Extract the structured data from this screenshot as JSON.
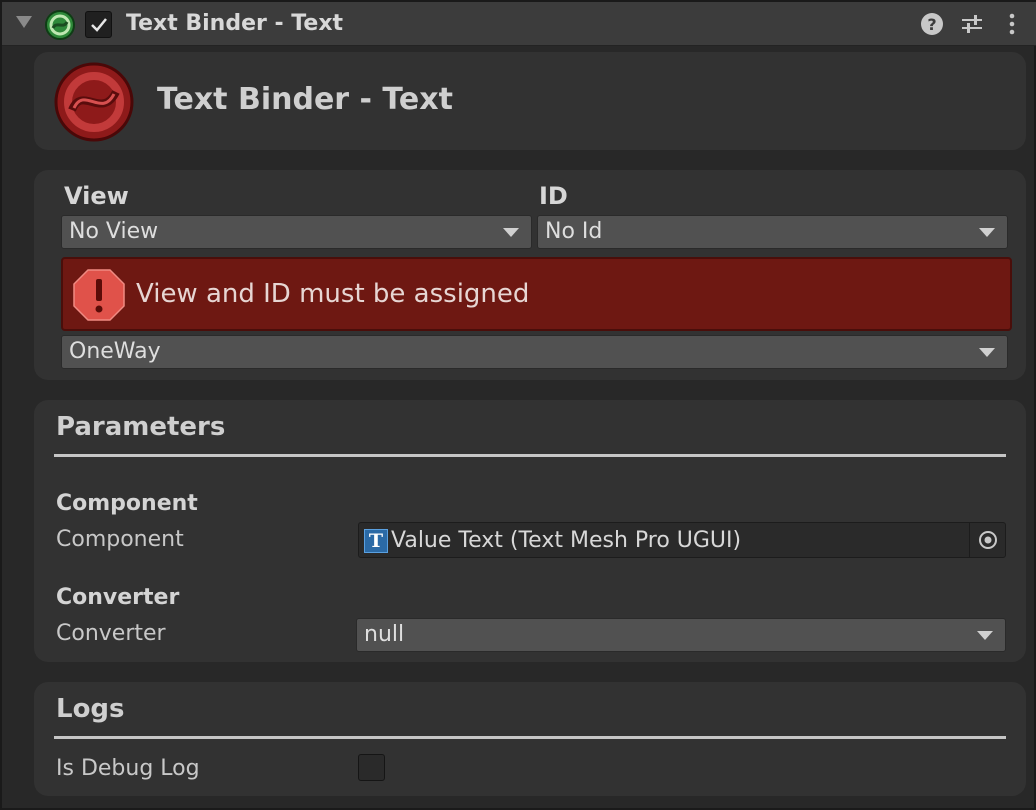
{
  "header": {
    "title": "Text Binder - Text",
    "enabled": true,
    "icons": [
      "foldout-arrow-icon",
      "binder-logo-icon",
      "help-icon",
      "presets-icon",
      "context-menu-icon"
    ]
  },
  "title_panel": {
    "title": "Text Binder - Text"
  },
  "binding": {
    "view_label": "View",
    "view_value": "No View",
    "id_label": "ID",
    "id_value": "No Id",
    "error_message": "View and ID must be assigned",
    "mode_value": "OneWay"
  },
  "parameters": {
    "title": "Parameters",
    "component_header": "Component",
    "component_label": "Component",
    "component_value": "Value Text (Text Mesh Pro UGUI)",
    "converter_header": "Converter",
    "converter_label": "Converter",
    "converter_value": "null"
  },
  "logs": {
    "title": "Logs",
    "debug_label": "Is Debug Log",
    "debug_checked": false
  },
  "colors": {
    "background": "#282828",
    "panel": "#323232",
    "error": "#6e1812",
    "dropdown": "#515151"
  }
}
